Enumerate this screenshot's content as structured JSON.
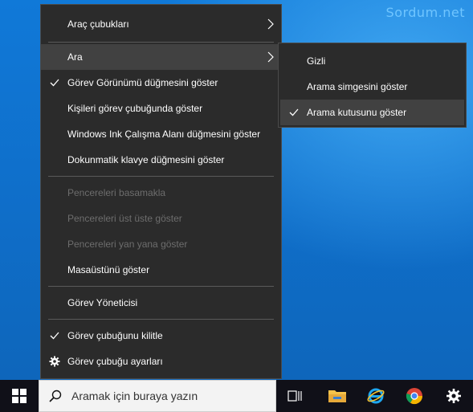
{
  "watermark": "Sordum.net",
  "menu": {
    "items": [
      {
        "label": "Araç çubukları",
        "checked": false,
        "arrow": true
      },
      {
        "label": "Ara",
        "checked": false,
        "arrow": true,
        "highlighted": true
      },
      {
        "label": "Görev Görünümü düğmesini göster",
        "checked": true
      },
      {
        "label": "Kişileri görev çubuğunda göster",
        "checked": false
      },
      {
        "label": "Windows Ink Çalışma Alanı düğmesini göster",
        "checked": false
      },
      {
        "label": "Dokunmatik klavye düğmesini göster",
        "checked": false
      },
      {
        "label": "Pencereleri basamakla",
        "disabled": true
      },
      {
        "label": "Pencereleri üst üste göster",
        "disabled": true
      },
      {
        "label": "Pencereleri yan yana göster",
        "disabled": true
      },
      {
        "label": "Masaüstünü göster"
      },
      {
        "label": "Görev Yöneticisi"
      },
      {
        "label": "Görev çubuğunu kilitle",
        "checked": true
      },
      {
        "label": "Görev çubuğu ayarları",
        "icon": "gear-icon"
      }
    ]
  },
  "submenu": {
    "items": [
      {
        "label": "Gizli",
        "checked": false
      },
      {
        "label": "Arama simgesini göster",
        "checked": false
      },
      {
        "label": "Arama kutusunu göster",
        "checked": true,
        "highlighted": true
      }
    ]
  },
  "taskbar": {
    "search_placeholder": "Aramak için buraya yazın",
    "icons": [
      "windows-start-icon",
      "task-view-icon",
      "file-explorer-icon",
      "internet-explorer-icon",
      "chrome-icon",
      "settings-gear-icon"
    ]
  },
  "colors": {
    "menu_bg": "#2b2b2b",
    "menu_highlight": "#414141",
    "taskbar_bg": "#101018",
    "desktop_blue": "#0f6ec9"
  }
}
